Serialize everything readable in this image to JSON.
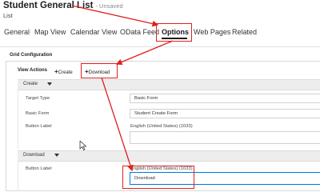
{
  "header": {
    "title": "Student General List",
    "status": "- Unsaved",
    "subtitle": "List"
  },
  "tabs": [
    {
      "label": "General"
    },
    {
      "label": "Map View"
    },
    {
      "label": "Calendar View"
    },
    {
      "label": "OData Feed"
    },
    {
      "label": "Options",
      "active": true
    },
    {
      "label": "Web Pages"
    },
    {
      "label": "Related"
    }
  ],
  "grid": {
    "section_title": "Grid Configuration",
    "view_actions_label": "View Actions",
    "create_button": "Create",
    "download_button": "Download"
  },
  "create_section": {
    "label": "Create",
    "target_type_label": "Target Type",
    "target_type_value": "Basic Form",
    "basic_form_label": "Basic Form",
    "basic_form_value": "Student Create Form",
    "button_label_label": "Button Label",
    "language": "English (United States) (1033)"
  },
  "download_section": {
    "label": "Download",
    "button_label_label": "Button Label",
    "language": "English (United States) (1033)",
    "button_label_value": "Download"
  },
  "colors": {
    "highlight": "#e0201f",
    "bar": "#ededed"
  }
}
